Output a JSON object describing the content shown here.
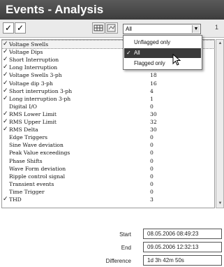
{
  "window": {
    "title": "Events - Analysis"
  },
  "toolbar": {
    "check_all": "✓",
    "check_single": "✓",
    "filter_value": "All",
    "right_glyph": "1"
  },
  "filter_menu": {
    "options": [
      {
        "label": "Unflagged only",
        "selected": false
      },
      {
        "label": "All",
        "selected": true
      },
      {
        "label": "Flagged only",
        "selected": false
      }
    ]
  },
  "events": [
    {
      "checked": true,
      "name": "Voltage Swells",
      "count": ""
    },
    {
      "checked": true,
      "name": "Voltage Dips",
      "count": ""
    },
    {
      "checked": true,
      "name": "Short Interruption",
      "count": ""
    },
    {
      "checked": true,
      "name": "Long Interruption",
      "count": ""
    },
    {
      "checked": true,
      "name": "Voltage Swells 3-ph",
      "count": "18"
    },
    {
      "checked": true,
      "name": "Voltage dip 3-ph",
      "count": "16"
    },
    {
      "checked": true,
      "name": "Short interruption 3-ph",
      "count": "4"
    },
    {
      "checked": true,
      "name": "Long interruption 3-ph",
      "count": "1"
    },
    {
      "checked": false,
      "name": "Digital I/O",
      "count": "0"
    },
    {
      "checked": true,
      "name": "RMS Lower Limit",
      "count": "30"
    },
    {
      "checked": true,
      "name": "RMS Upper Limit",
      "count": "32"
    },
    {
      "checked": true,
      "name": "RMS Delta",
      "count": "30"
    },
    {
      "checked": false,
      "name": "Edge Triggers",
      "count": "0"
    },
    {
      "checked": false,
      "name": "Sine Wave deviation",
      "count": "0"
    },
    {
      "checked": false,
      "name": "Peak Value exceedings",
      "count": "0"
    },
    {
      "checked": false,
      "name": "Phase Shifts",
      "count": "0"
    },
    {
      "checked": false,
      "name": "Wave Form deviation",
      "count": "0"
    },
    {
      "checked": false,
      "name": "Ripple control signal",
      "count": "0"
    },
    {
      "checked": false,
      "name": "Transient events",
      "count": "0"
    },
    {
      "checked": false,
      "name": "Time Trigger",
      "count": "0"
    },
    {
      "checked": true,
      "name": "THD",
      "count": "3"
    }
  ],
  "time_range": {
    "start_label": "Start",
    "start_value": "08.05.2006  08:49:23",
    "end_label": "End",
    "end_value": "09.05.2006  12:32:13",
    "difference_label": "Difference",
    "difference_value": "1d  3h  42m  50s"
  },
  "colors": {
    "title_bg": "#4a4a4a",
    "menu_highlight": "#3a3a3a"
  }
}
